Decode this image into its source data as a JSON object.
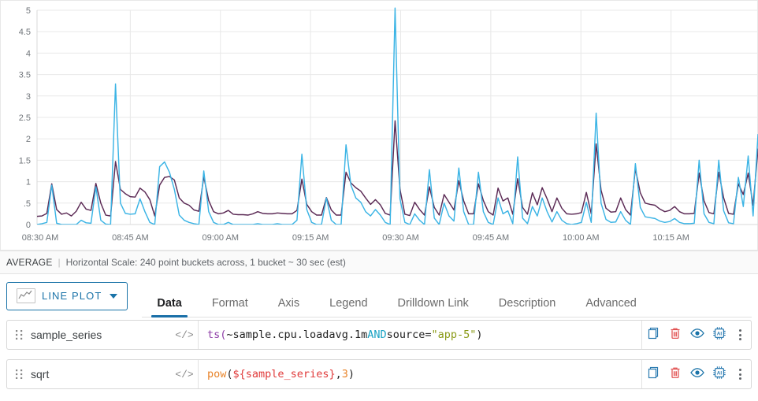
{
  "chart_data": {
    "type": "line",
    "title": "",
    "xlabel": "",
    "ylabel": "",
    "ylim": [
      0,
      5
    ],
    "xlim": [
      "08:30 AM",
      "10:25 AM"
    ],
    "grid": true,
    "legend_position": "none",
    "y_ticks": [
      "5",
      "4.5",
      "4",
      "3.5",
      "3",
      "2.5",
      "2",
      "1.5",
      "1",
      ".5",
      "0"
    ],
    "y_tick_values": [
      5,
      4.5,
      4,
      3.5,
      3,
      2.5,
      2,
      1.5,
      1,
      0.5,
      0
    ],
    "x_ticks": [
      "08:30 AM",
      "08:45 AM",
      "09:00 AM",
      "09:15 AM",
      "09:30 AM",
      "09:45 AM",
      "10:00 AM",
      "10:15 AM"
    ],
    "colors": {
      "sample_series": "#5b2a55",
      "sqrt": "#3bb4e5"
    },
    "series": [
      {
        "name": "sample_series",
        "color": "#5b2a55",
        "values": [
          0.19,
          0.2,
          0.26,
          0.95,
          0.35,
          0.24,
          0.27,
          0.2,
          0.31,
          0.52,
          0.36,
          0.33,
          0.96,
          0.5,
          0.22,
          0.2,
          1.47,
          0.82,
          0.72,
          0.65,
          0.64,
          0.85,
          0.76,
          0.58,
          0.2,
          0.92,
          1.1,
          1.12,
          1.04,
          0.62,
          0.5,
          0.45,
          0.34,
          0.31,
          1.11,
          0.56,
          0.3,
          0.25,
          0.27,
          0.33,
          0.24,
          0.23,
          0.23,
          0.22,
          0.25,
          0.3,
          0.26,
          0.25,
          0.25,
          0.27,
          0.26,
          0.25,
          0.25,
          0.33,
          1.06,
          0.47,
          0.3,
          0.22,
          0.22,
          0.63,
          0.34,
          0.22,
          0.22,
          1.22,
          0.97,
          0.86,
          0.78,
          0.62,
          0.47,
          0.58,
          0.46,
          0.26,
          0.22,
          2.42,
          0.82,
          0.24,
          0.21,
          0.52,
          0.35,
          0.22,
          0.88,
          0.4,
          0.22,
          0.7,
          0.52,
          0.34,
          1.02,
          0.55,
          0.25,
          0.25,
          0.95,
          0.56,
          0.3,
          0.22,
          0.85,
          0.55,
          0.62,
          0.24,
          1.07,
          0.4,
          0.24,
          0.74,
          0.46,
          0.86,
          0.6,
          0.3,
          0.62,
          0.38,
          0.25,
          0.24,
          0.25,
          0.28,
          0.75,
          0.25,
          1.88,
          0.8,
          0.38,
          0.29,
          0.3,
          0.62,
          0.35,
          0.22,
          1.3,
          0.74,
          0.5,
          0.47,
          0.45,
          0.36,
          0.3,
          0.33,
          0.42,
          0.3,
          0.25,
          0.25,
          0.26,
          1.2,
          0.55,
          0.28,
          0.25,
          1.22,
          0.62,
          0.26,
          0.24,
          0.95,
          0.7,
          1.2,
          0.45,
          1.76
        ]
      },
      {
        "name": "sqrt",
        "color": "#3bb4e5",
        "values": [
          0.0,
          0.02,
          0.05,
          0.92,
          0.03,
          0.0,
          0.0,
          0.0,
          0.0,
          0.1,
          0.04,
          0.03,
          0.88,
          0.1,
          0.01,
          0.0,
          3.28,
          0.5,
          0.26,
          0.24,
          0.25,
          0.6,
          0.3,
          0.05,
          0.0,
          1.35,
          1.46,
          1.22,
          0.82,
          0.22,
          0.1,
          0.05,
          0.02,
          0.0,
          1.25,
          0.3,
          0.05,
          0.0,
          0.0,
          0.05,
          0.0,
          0.0,
          0.0,
          0.0,
          0.0,
          0.02,
          0.0,
          0.0,
          0.0,
          0.02,
          0.0,
          0.0,
          0.0,
          0.1,
          1.64,
          0.35,
          0.05,
          0.0,
          0.0,
          0.62,
          0.1,
          0.0,
          0.0,
          1.86,
          0.92,
          0.62,
          0.52,
          0.3,
          0.2,
          0.35,
          0.22,
          0.05,
          0.0,
          5.05,
          0.6,
          0.05,
          0.0,
          0.25,
          0.1,
          0.0,
          1.28,
          0.15,
          0.0,
          0.5,
          0.2,
          0.08,
          1.32,
          0.3,
          0.0,
          0.0,
          1.22,
          0.3,
          0.05,
          0.0,
          0.62,
          0.25,
          0.32,
          0.02,
          1.58,
          0.15,
          0.02,
          0.42,
          0.2,
          0.62,
          0.3,
          0.06,
          0.3,
          0.1,
          0.02,
          0.0,
          0.02,
          0.05,
          0.52,
          0.05,
          2.6,
          0.5,
          0.12,
          0.05,
          0.06,
          0.3,
          0.1,
          0.0,
          1.42,
          0.4,
          0.18,
          0.16,
          0.14,
          0.08,
          0.05,
          0.07,
          0.14,
          0.05,
          0.02,
          0.02,
          0.03,
          1.5,
          0.25,
          0.05,
          0.02,
          1.5,
          0.32,
          0.04,
          0.02,
          1.1,
          0.42,
          1.6,
          0.2,
          2.1
        ]
      }
    ]
  },
  "status": {
    "aggregation": "AVERAGE",
    "separator": "|",
    "scale": "Horizontal Scale: 240 point buckets across, 1 bucket ~ 30 sec (est)"
  },
  "toolbar": {
    "plot_type_label": "LINE PLOT",
    "plot_type_icon": "line-chart-icon",
    "chevron_icon": "chevron-down-icon"
  },
  "tabs": [
    {
      "label": "Data",
      "active": true
    },
    {
      "label": "Format",
      "active": false
    },
    {
      "label": "Axis",
      "active": false
    },
    {
      "label": "Legend",
      "active": false
    },
    {
      "label": "Drilldown Link",
      "active": false
    },
    {
      "label": "Description",
      "active": false
    },
    {
      "label": "Advanced",
      "active": false
    }
  ],
  "expressions": [
    {
      "name": "sample_series",
      "code_toggle": "</>",
      "tokens": [
        {
          "t": "ts(",
          "c": "tk-fn-purple"
        },
        {
          "t": "~sample.cpu.loadavg.1m ",
          "c": "tk-plain"
        },
        {
          "t": "AND",
          "c": "tk-kw"
        },
        {
          "t": " source=",
          "c": "tk-plain"
        },
        {
          "t": "\"app-5\"",
          "c": "tk-str"
        },
        {
          "t": ")",
          "c": "tk-plain"
        }
      ]
    },
    {
      "name": "sqrt",
      "code_toggle": "</>",
      "tokens": [
        {
          "t": "pow",
          "c": "tk-fn-orange"
        },
        {
          "t": "(",
          "c": "tk-plain"
        },
        {
          "t": "${sample_series}",
          "c": "tk-var"
        },
        {
          "t": ", ",
          "c": "tk-plain"
        },
        {
          "t": "3",
          "c": "tk-num"
        },
        {
          "t": ")",
          "c": "tk-plain"
        }
      ]
    }
  ],
  "row_actions": [
    {
      "icon": "copy-icon",
      "color": "#2a7ab0"
    },
    {
      "icon": "trash-icon",
      "color": "#e04a4a"
    },
    {
      "icon": "eye-icon",
      "color": "#1a73a8"
    },
    {
      "icon": "ai-chip-icon",
      "color": "#2a7ab0"
    },
    {
      "icon": "kebab-menu-icon",
      "color": "#5f6368"
    }
  ],
  "colors": {
    "accent": "#1a73a8",
    "tab_active_underline": "#1a6fa8",
    "grid": "#e8e8e8"
  }
}
